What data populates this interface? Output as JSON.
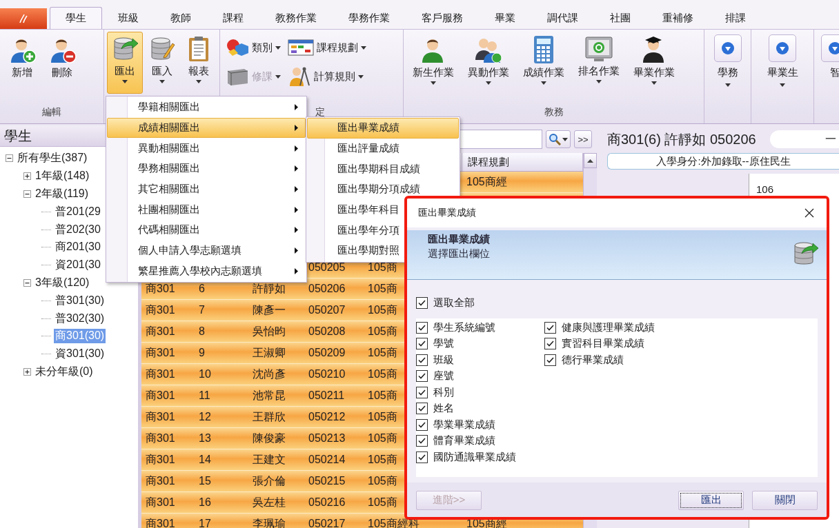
{
  "tabs": [
    {
      "label": "學生",
      "selected": true
    },
    {
      "label": "班級",
      "selected": false
    },
    {
      "label": "教師",
      "selected": false
    },
    {
      "label": "課程",
      "selected": false
    },
    {
      "label": "教務作業",
      "selected": false
    },
    {
      "label": "學務作業",
      "selected": false
    },
    {
      "label": "客戶服務",
      "selected": false
    },
    {
      "label": "畢業",
      "selected": false
    },
    {
      "label": "調代課",
      "selected": false
    },
    {
      "label": "社團",
      "selected": false
    },
    {
      "label": "重補修",
      "selected": false
    },
    {
      "label": "排課",
      "selected": false
    }
  ],
  "ribbon": [
    {
      "kind": "large",
      "label": "編輯",
      "buttons": [
        {
          "label": "新增",
          "pressed": false,
          "dropdown": false
        },
        {
          "label": "刪除",
          "pressed": false,
          "dropdown": false
        }
      ]
    },
    {
      "kind": "large",
      "buttons": [
        {
          "label": "匯出",
          "pressed": true,
          "dropdown": true
        },
        {
          "label": "匯入",
          "pressed": false,
          "dropdown": true
        },
        {
          "label": "報表",
          "pressed": false,
          "dropdown": true
        }
      ]
    },
    {
      "kind": "small",
      "label": "定",
      "buttons": [
        {
          "label": "類別",
          "disabled": false
        },
        {
          "label": "修課",
          "disabled": true
        },
        {
          "label": "課程規劃",
          "disabled": false
        },
        {
          "label": "計算規則",
          "disabled": false
        }
      ]
    },
    {
      "kind": "large",
      "label": "教務",
      "buttons": [
        {
          "label": "新生作業",
          "pressed": false,
          "dropdown": true
        },
        {
          "label": "異動作業",
          "pressed": false,
          "dropdown": true
        },
        {
          "label": "成績作業",
          "pressed": false,
          "dropdown": true
        },
        {
          "label": "排名作業",
          "pressed": false,
          "dropdown": true
        },
        {
          "label": "畢業作業",
          "pressed": false,
          "dropdown": true
        }
      ]
    },
    {
      "kind": "collapsed",
      "buttons": [
        {
          "label": "學務",
          "dropdown": true
        }
      ]
    },
    {
      "kind": "collapsed",
      "buttons": [
        {
          "label": "畢業生",
          "dropdown": true
        }
      ]
    },
    {
      "kind": "collapsed",
      "buttons": [
        {
          "label": "智",
          "dropdown": false
        }
      ]
    }
  ],
  "left_panel": {
    "title": "學生",
    "tree": [
      {
        "label": "所有學生(387)",
        "expanded": true,
        "selected": false,
        "children": [
          {
            "label": "1年級(148)",
            "expanded": false,
            "selected": false
          },
          {
            "label": "2年級(119)",
            "expanded": true,
            "selected": false,
            "children": [
              {
                "label": "普201(29",
                "selected": false
              },
              {
                "label": "普202(30",
                "selected": false
              },
              {
                "label": "商201(30",
                "selected": false
              },
              {
                "label": "資201(30",
                "selected": false
              }
            ]
          },
          {
            "label": "3年級(120)",
            "expanded": true,
            "selected": false,
            "children": [
              {
                "label": "普301(30)",
                "selected": false
              },
              {
                "label": "普302(30)",
                "selected": false
              },
              {
                "label": "商301(30)",
                "selected": true
              },
              {
                "label": "資301(30)",
                "selected": false
              }
            ]
          },
          {
            "label": "未分年級(0)",
            "expanded": false,
            "selected": false
          }
        ]
      }
    ]
  },
  "grid": {
    "search_button": {
      "label": ">>"
    },
    "header": {
      "course_plan": "課程規劃"
    },
    "rows": [
      {
        "course_plan": "105商經"
      },
      {},
      {},
      {},
      {
        "student_no": "050205",
        "department": "105商"
      },
      {
        "class": "商301",
        "seat": "6",
        "name": "許靜如",
        "student_no": "050206",
        "department": "105商"
      },
      {
        "class": "商301",
        "seat": "7",
        "name": "陳彥一",
        "student_no": "050207",
        "department": "105商"
      },
      {
        "class": "商301",
        "seat": "8",
        "name": "吳怡昀",
        "student_no": "050208",
        "department": "105商"
      },
      {
        "class": "商301",
        "seat": "9",
        "name": "王淑卿",
        "student_no": "050209",
        "department": "105商"
      },
      {
        "class": "商301",
        "seat": "10",
        "name": "沈尚彥",
        "student_no": "050210",
        "department": "105商"
      },
      {
        "class": "商301",
        "seat": "11",
        "name": "池常昆",
        "student_no": "050211",
        "department": "105商"
      },
      {
        "class": "商301",
        "seat": "12",
        "name": "王群欣",
        "student_no": "050212",
        "department": "105商"
      },
      {
        "class": "商301",
        "seat": "13",
        "name": "陳俊豪",
        "student_no": "050213",
        "department": "105商"
      },
      {
        "class": "商301",
        "seat": "14",
        "name": "王建文",
        "student_no": "050214",
        "department": "105商"
      },
      {
        "class": "商301",
        "seat": "15",
        "name": "張介倫",
        "student_no": "050215",
        "department": "105商"
      },
      {
        "class": "商301",
        "seat": "16",
        "name": "吳左桂",
        "student_no": "050216",
        "department": "105商"
      },
      {
        "class": "商301",
        "seat": "17",
        "name": "李珮瑜",
        "student_no": "050217",
        "department": "105商經科",
        "course_plan": "105商經"
      }
    ]
  },
  "right_panel": {
    "title": "商301(6) 許靜如 050206",
    "status": "一",
    "identity": "入學身分:外加錄取--原住民生",
    "table_value": "106"
  },
  "menu": {
    "items": [
      {
        "label": "學籍相關匯出",
        "selected": false
      },
      {
        "label": "成績相關匯出",
        "selected": true
      },
      {
        "label": "異動相關匯出",
        "selected": false
      },
      {
        "label": "學務相關匯出",
        "selected": false
      },
      {
        "label": "其它相關匯出",
        "selected": false
      },
      {
        "label": "社團相關匯出",
        "selected": false
      },
      {
        "label": "代碼相關匯出",
        "selected": false
      },
      {
        "label": "個人申請入學志願選填",
        "selected": false
      },
      {
        "label": "繁星推薦入學校內志願選填",
        "selected": false
      }
    ]
  },
  "submenu": {
    "items": [
      {
        "label": "匯出畢業成績",
        "selected": true
      },
      {
        "label": "匯出評量成績",
        "selected": false
      },
      {
        "label": "匯出學期科目成績",
        "selected": false
      },
      {
        "label": "匯出學期分項成績",
        "selected": false
      },
      {
        "label": "匯出學年科目",
        "selected": false
      },
      {
        "label": "匯出學年分項",
        "selected": false
      },
      {
        "label": "匯出學期對照",
        "selected": false
      }
    ]
  },
  "dialog": {
    "title": "匯出畢業成績",
    "header_title": "匯出畢業成績",
    "header_subtitle": "選擇匯出欄位",
    "select_all": {
      "label": "選取全部",
      "checked": true
    },
    "fields": [
      {
        "label": "學生系統編號",
        "checked": true
      },
      {
        "label": "學號",
        "checked": true
      },
      {
        "label": "班級",
        "checked": true
      },
      {
        "label": "座號",
        "checked": true
      },
      {
        "label": "科別",
        "checked": true
      },
      {
        "label": "姓名",
        "checked": true
      },
      {
        "label": "學業畢業成績",
        "checked": true
      },
      {
        "label": "體育畢業成績",
        "checked": true
      },
      {
        "label": "國防通識畢業成績",
        "checked": true
      },
      {
        "label": "健康與護理畢業成績",
        "checked": true
      },
      {
        "label": "實習科目畢業成績",
        "checked": true
      },
      {
        "label": "德行畢業成績",
        "checked": true
      }
    ],
    "buttons": {
      "advanced": {
        "label": "進階>>",
        "disabled": true
      },
      "export": {
        "label": "匯出",
        "focused": true
      },
      "close": {
        "label": "關閉"
      }
    }
  }
}
